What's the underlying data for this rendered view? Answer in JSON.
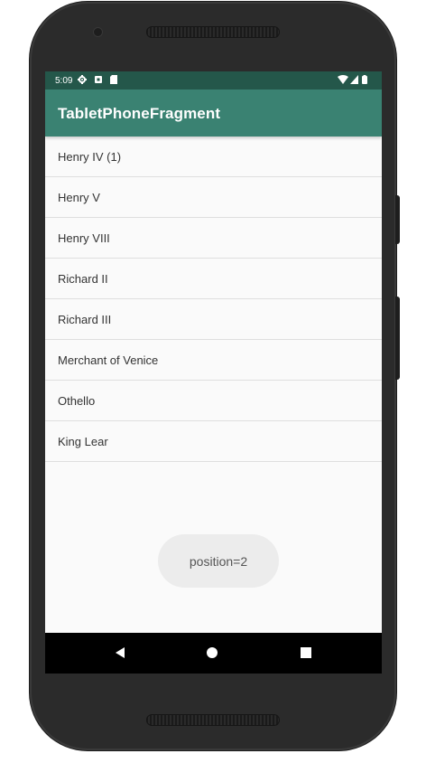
{
  "status_bar": {
    "time": "5:09",
    "left_icons": [
      "settings-icon",
      "notification-icon",
      "sd-card-icon"
    ],
    "right_icons": [
      "wifi-icon",
      "signal-icon",
      "battery-icon"
    ]
  },
  "app_bar": {
    "title": "TabletPhoneFragment",
    "color": "#3a8272",
    "status_color": "#24574a"
  },
  "list": {
    "items": [
      {
        "label": "Henry IV (1)"
      },
      {
        "label": "Henry V"
      },
      {
        "label": "Henry VIII"
      },
      {
        "label": "Richard II"
      },
      {
        "label": "Richard III"
      },
      {
        "label": "Merchant of Venice"
      },
      {
        "label": "Othello"
      },
      {
        "label": "King Lear"
      }
    ]
  },
  "toast": {
    "text": "position=2"
  },
  "nav_bar": {
    "buttons": [
      "back-icon",
      "home-icon",
      "recents-icon"
    ]
  }
}
